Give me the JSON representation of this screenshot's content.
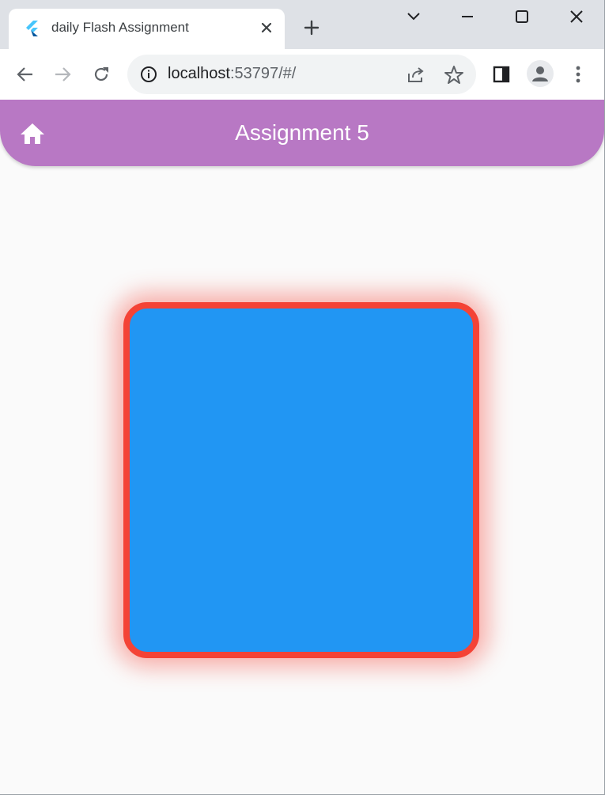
{
  "browser": {
    "tab": {
      "title": "daily Flash Assignment",
      "favicon": "flutter-logo-icon"
    },
    "address": {
      "host": "localhost",
      "rest": ":53797/#/"
    },
    "colors": {
      "frame": "#dee1e6",
      "toolbar": "#ffffff",
      "omnibox": "#f1f3f4"
    }
  },
  "app": {
    "title": "Assignment 5",
    "home_icon": "home-icon",
    "colors": {
      "appbar": "#b878c4",
      "background": "#fafafa",
      "box_fill": "#2196f3",
      "box_border": "#f44336",
      "box_glow": "#f44336"
    }
  }
}
